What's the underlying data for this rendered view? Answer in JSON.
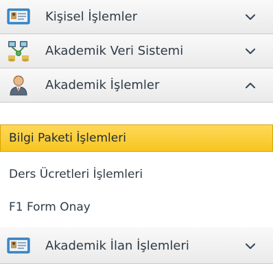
{
  "menu": {
    "sections": [
      {
        "label": "Kişisel İşlemler",
        "icon": "id-card-icon",
        "expanded": false
      },
      {
        "label": "Akademik Veri Sistemi",
        "icon": "network-icon",
        "expanded": false
      },
      {
        "label": "Akademik İşlemler",
        "icon": "user-icon",
        "expanded": true
      },
      {
        "label": "Akademik İlan İşlemleri",
        "icon": "id-card-icon",
        "expanded": false
      }
    ],
    "items": [
      {
        "label": "Bilgi Paketi İşlemleri",
        "selected": true
      },
      {
        "label": "Ders Ücretleri İşlemleri",
        "selected": false
      },
      {
        "label": "F1 Form Onay",
        "selected": false
      }
    ]
  },
  "colors": {
    "header_bg": "#efefef",
    "selected_bg": "#f7c51f",
    "text": "#2e3a46",
    "chevron": "#3a4a5a"
  }
}
